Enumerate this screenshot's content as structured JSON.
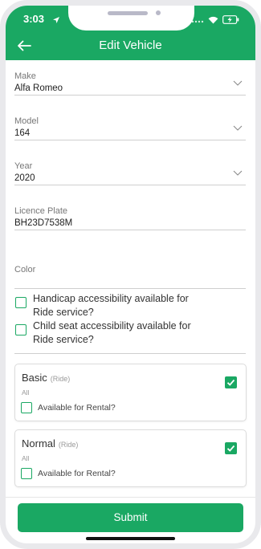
{
  "status_bar": {
    "time": "3:03"
  },
  "app_bar": {
    "title": "Edit Vehicle"
  },
  "form": {
    "make": {
      "label": "Make",
      "value": "Alfa Romeo"
    },
    "model": {
      "label": "Model",
      "value": "164"
    },
    "year": {
      "label": "Year",
      "value": "2020"
    },
    "plate": {
      "label": "Licence Plate",
      "value": "BH23D7538M"
    },
    "color": {
      "label": "Color",
      "value": ""
    }
  },
  "accessibility": {
    "handicap": "Handicap accessibility available for Ride service?",
    "child_seat": "Child seat accessibility available for Ride service?"
  },
  "services": [
    {
      "name": "Basic",
      "type": "(Ride)",
      "scope": "All",
      "rental_label": "Available for Rental?"
    },
    {
      "name": "Normal",
      "type": "(Ride)",
      "scope": "All",
      "rental_label": "Available for Rental?"
    }
  ],
  "submit_label": "Submit",
  "colors": {
    "accent": "#1aa863"
  },
  "icons": [
    "location-arrow-icon",
    "wifi-icon",
    "battery-charging-icon",
    "back-arrow-icon",
    "chevron-down-icon",
    "checkmark-icon"
  ]
}
